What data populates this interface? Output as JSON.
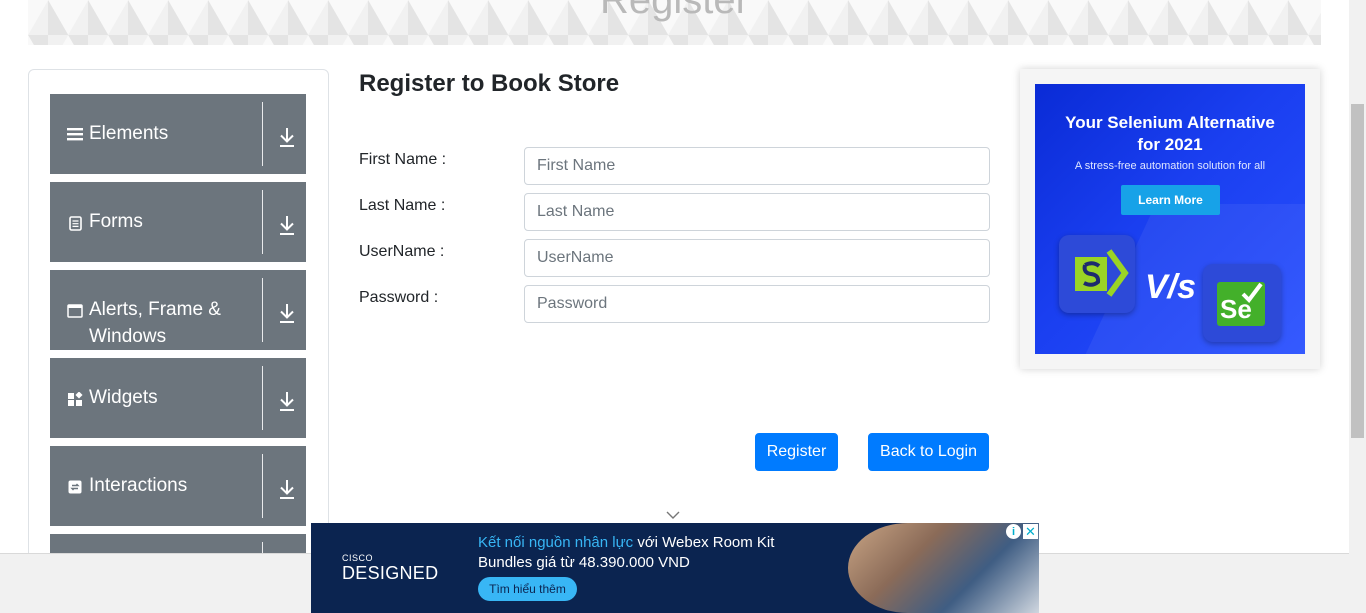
{
  "header": {
    "title": "Register"
  },
  "sidebar": {
    "groups": [
      {
        "label": "Elements",
        "icon": "menu-icon"
      },
      {
        "label": "Forms",
        "icon": "document-icon"
      },
      {
        "label": "Alerts, Frame & Windows",
        "icon": "window-icon"
      },
      {
        "label": "Widgets",
        "icon": "widgets-icon"
      },
      {
        "label": "Interactions",
        "icon": "interactions-icon"
      },
      {
        "label": "",
        "icon": ""
      }
    ]
  },
  "form": {
    "title": "Register to Book Store",
    "fields": [
      {
        "label": "First Name :",
        "placeholder": "First Name",
        "value": ""
      },
      {
        "label": "Last Name :",
        "placeholder": "Last Name",
        "value": ""
      },
      {
        "label": "UserName :",
        "placeholder": "UserName",
        "value": ""
      },
      {
        "label": "Password :",
        "placeholder": "Password",
        "value": ""
      }
    ],
    "register_label": "Register",
    "back_label": "Back to Login"
  },
  "right_ad": {
    "headline_line1": "Your Selenium Alternative",
    "headline_line2": "for 2021",
    "subline": "A stress-free automation solution for all",
    "button": "Learn More",
    "vs": "V/s",
    "se_logo": "Se"
  },
  "bottom_ad": {
    "brand_small": "CISCO",
    "brand_big": "DESIGNED",
    "text_highlight": "Kết nối nguồn nhân lực",
    "text_rest": " với Webex Room Kit Bundles giá từ 48.390.000 VND",
    "button": "Tìm hiểu thêm",
    "info": "i",
    "close": "✕"
  },
  "colors": {
    "primary": "#007bff",
    "sidebar_group": "#6c757d",
    "ad_blue": "#1a3ff0",
    "bottom_ad_bg": "#0b2450",
    "bottom_ad_accent": "#38b6f5"
  }
}
